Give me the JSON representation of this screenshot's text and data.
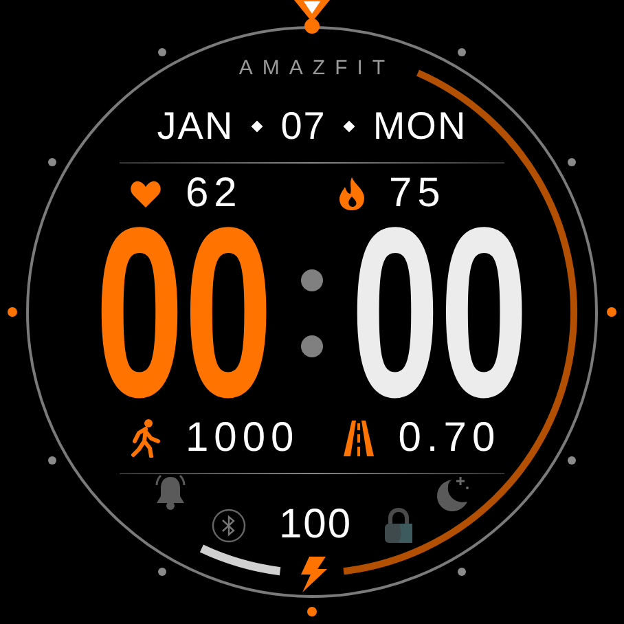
{
  "brand": "AMAZFIT",
  "date": {
    "month": "JAN",
    "day": "07",
    "weekday": "MON"
  },
  "heart_rate": {
    "value": "62"
  },
  "calories": {
    "value": "75"
  },
  "time": {
    "hours": "00",
    "minutes": "00"
  },
  "steps": {
    "value": "1000"
  },
  "distance": {
    "value": "0.70"
  },
  "battery": {
    "value": "100"
  }
}
